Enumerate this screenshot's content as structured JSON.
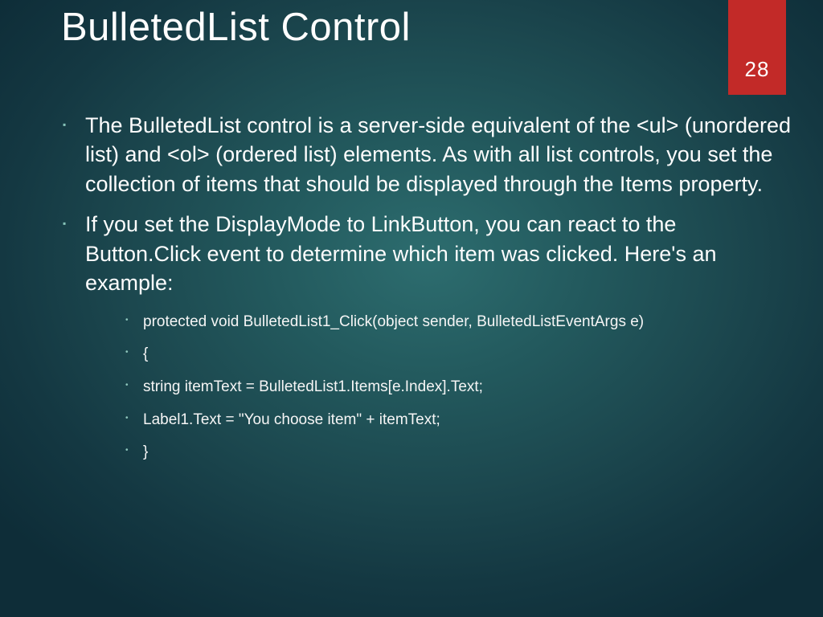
{
  "title": "BulletedList Control",
  "ribbon": {
    "page": "28"
  },
  "bullets": [
    {
      "text": "The BulletedList control is a server-side equivalent of the <ul> (unordered list) and <ol> (ordered list) elements. As with all list controls, you set the collection of items that should be displayed through the Items property."
    },
    {
      "text": "If you set the DisplayMode to LinkButton, you can react to the Button.Click event to determine which item was clicked. Here's an example:",
      "sub": [
        "protected void BulletedList1_Click(object sender, BulletedListEventArgs e)",
        "{",
        "string itemText = BulletedList1.Items[e.Index].Text;",
        "Label1.Text = \"You choose item\" + itemText;",
        "}"
      ]
    }
  ]
}
